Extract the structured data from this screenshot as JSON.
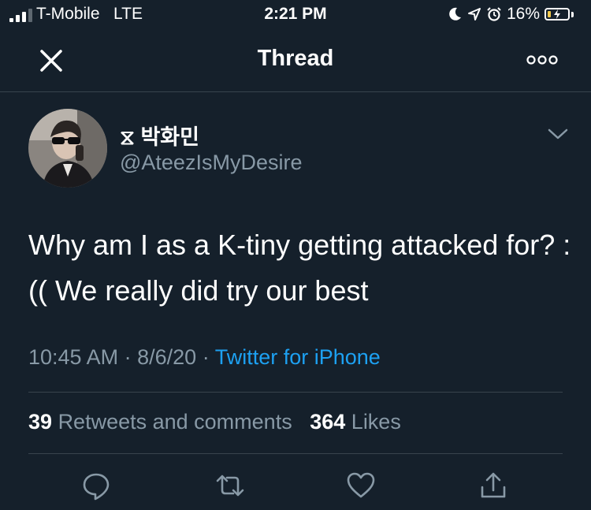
{
  "status_bar": {
    "carrier": "T-Mobile",
    "network": "LTE",
    "time": "2:21 PM",
    "battery_percent": "16%",
    "battery_level": 0.16,
    "signal_bars_filled": 3,
    "signal_bars_total": 4,
    "icons": [
      "moon-icon",
      "location-arrow-icon",
      "alarm-icon",
      "charging-bolt-icon"
    ]
  },
  "nav": {
    "title": "Thread",
    "close_icon": "close-icon",
    "more_icon": "more-options-icon"
  },
  "tweet": {
    "display_name": "⧖ 박화민",
    "handle": "@AteezIsMyDesire",
    "text": "Why am I as a K-tiny getting attacked for? :(( We really did try our best",
    "time": "10:45 AM",
    "date": "8/6/20",
    "separator": "·",
    "source": "Twitter for iPhone",
    "retweets_count": "39",
    "retweets_label": "Retweets and comments",
    "likes_count": "364",
    "likes_label": "Likes",
    "action_icons": [
      "reply-icon",
      "retweet-icon",
      "like-icon",
      "share-icon"
    ]
  },
  "colors": {
    "background": "#15202b",
    "text": "#ffffff",
    "muted": "#8899a6",
    "accent": "#1da1f2",
    "divider": "#38444d",
    "battery": "#f2c94c"
  }
}
